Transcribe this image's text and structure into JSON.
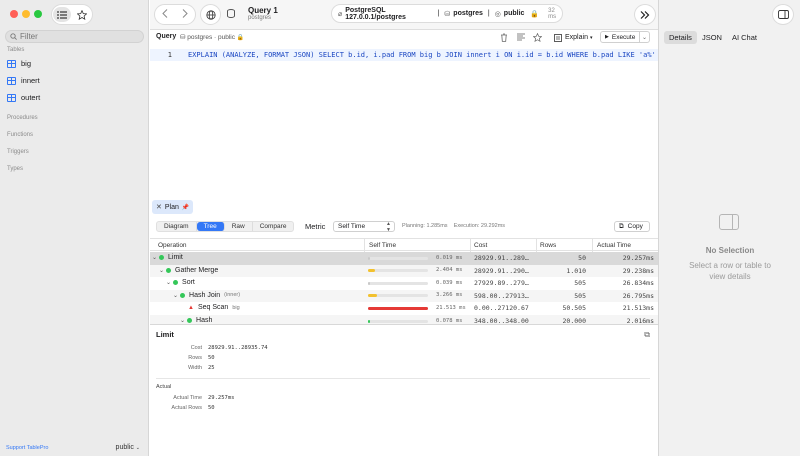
{
  "sidebar": {
    "filter_placeholder": "Filter",
    "sections": {
      "tables": "Tables",
      "procedures": "Procedures",
      "functions": "Functions",
      "triggers": "Triggers",
      "types": "Types"
    },
    "tables": [
      {
        "label": "big"
      },
      {
        "label": "innert"
      },
      {
        "label": "outert"
      }
    ],
    "footer_link": "Support TablePro",
    "schema_selector": "public"
  },
  "topbar": {
    "query_title": "Query 1",
    "query_subtitle": "postgres",
    "connection": "PostgreSQL 127.0.0.1/postgres",
    "database": "postgres",
    "schema": "public",
    "latency": "32 ms"
  },
  "query_toolbar": {
    "label": "Query",
    "schema_path": "postgres · public",
    "explain_label": "Explain",
    "execute_label": "Execute"
  },
  "editor": {
    "line_number": "1",
    "code": "EXPLAIN (ANALYZE, FORMAT JSON) SELECT b.id, i.pad FROM big b JOIN innert i ON i.id = b.id WHERE b.pad LIKE 'a%'"
  },
  "plan": {
    "tab_label": "Plan",
    "views": [
      "Diagram",
      "Tree",
      "Raw",
      "Compare"
    ],
    "active_view": "Tree",
    "metric_label": "Metric",
    "metric_value": "Self Time",
    "planning": "Planning: 1.285ms",
    "execution": "Execution: 29.292ms",
    "copy_label": "Copy",
    "columns": {
      "operation": "Operation",
      "self_time": "Self Time",
      "cost": "Cost",
      "rows": "Rows",
      "actual_time": "Actual Time"
    },
    "rows": [
      {
        "name": "Limit",
        "suffix": "",
        "self_time": "0.019 ms",
        "cost": "28929.91..289…",
        "rows": "50",
        "actual_time": "29.257ms",
        "bar": 0.01,
        "bar_color": "#c9c9c9",
        "marker": "dot",
        "depth": 0
      },
      {
        "name": "Gather Merge",
        "suffix": "",
        "self_time": "2.404 ms",
        "cost": "28929.91..290…",
        "rows": "1.010",
        "actual_time": "29.238ms",
        "bar": 0.11,
        "bar_color": "#f2c12e",
        "marker": "dot",
        "depth": 1
      },
      {
        "name": "Sort",
        "suffix": "",
        "self_time": "0.039 ms",
        "cost": "27929.89..279…",
        "rows": "505",
        "actual_time": "26.834ms",
        "bar": 0.01,
        "bar_color": "#c9c9c9",
        "marker": "dot",
        "depth": 2
      },
      {
        "name": "Hash Join",
        "suffix": "(inner)",
        "self_time": "3.266 ms",
        "cost": "598.00..27913…",
        "rows": "505",
        "actual_time": "26.795ms",
        "bar": 0.15,
        "bar_color": "#f2c12e",
        "marker": "dot",
        "depth": 3
      },
      {
        "name": "Seq Scan",
        "suffix": "big",
        "self_time": "21.513 ms",
        "cost": "0.00..27120.67",
        "rows": "50.505",
        "actual_time": "21.513ms",
        "bar": 1.0,
        "bar_color": "#e53935",
        "marker": "triangle",
        "depth": 4
      },
      {
        "name": "Hash",
        "suffix": "",
        "self_time": "0.078 ms",
        "cost": "348.00..348.00",
        "rows": "20.000",
        "actual_time": "2.016ms",
        "bar": 0.01,
        "bar_color": "#34c759",
        "marker": "dot",
        "depth": 4
      }
    ]
  },
  "detail": {
    "title": "Limit",
    "fields": [
      {
        "label": "Cost",
        "value": "28929.91..28935.74"
      },
      {
        "label": "Rows",
        "value": "50"
      },
      {
        "label": "Width",
        "value": "25"
      }
    ],
    "actual_section": "Actual",
    "actual_fields": [
      {
        "label": "Actual Time",
        "value": "29.257ms"
      },
      {
        "label": "Actual Rows",
        "value": "50"
      }
    ]
  },
  "inspector": {
    "tabs": [
      "Details",
      "JSON",
      "AI Chat"
    ],
    "active_tab": "Details",
    "empty_title": "No Selection",
    "empty_subtitle": "Select a row or table to view details"
  }
}
